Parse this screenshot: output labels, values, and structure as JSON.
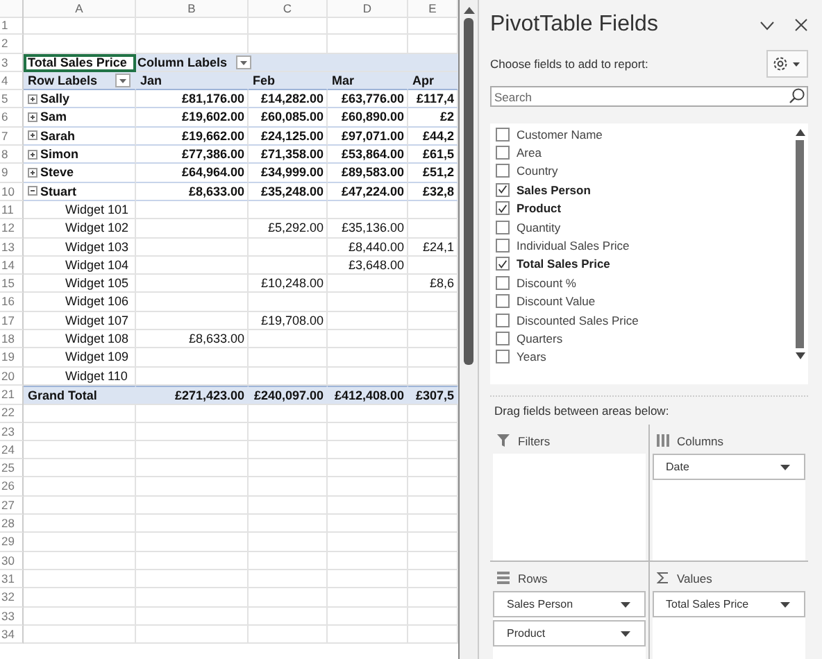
{
  "sheet": {
    "columns": [
      "A",
      "B",
      "C",
      "D",
      "E"
    ],
    "rows": [
      {
        "num": "1",
        "kind": "blank"
      },
      {
        "num": "2",
        "kind": "blank"
      },
      {
        "num": "3",
        "kind": "title",
        "cells": [
          {
            "text": "Total Sales Price",
            "selected": true
          },
          {
            "text": "Column Labels",
            "selected": false
          }
        ]
      },
      {
        "num": "4",
        "kind": "colhead",
        "label": "Row Labels",
        "values": [
          "Jan",
          "Feb",
          "Mar",
          "Apr"
        ]
      },
      {
        "num": "5",
        "kind": "group",
        "expanded": false,
        "label": "Sally",
        "values": [
          "£81,176.00",
          "£14,282.00",
          "£63,776.00",
          "£117,4"
        ]
      },
      {
        "num": "6",
        "kind": "group",
        "expanded": false,
        "label": "Sam",
        "values": [
          "£19,602.00",
          "£60,085.00",
          "£60,890.00",
          "£2"
        ]
      },
      {
        "num": "7",
        "kind": "group",
        "expanded": false,
        "label": "Sarah",
        "values": [
          "£19,662.00",
          "£24,125.00",
          "£97,071.00",
          "£44,2"
        ]
      },
      {
        "num": "8",
        "kind": "group",
        "expanded": false,
        "label": "Simon",
        "values": [
          "£77,386.00",
          "£71,358.00",
          "£53,864.00",
          "£61,5"
        ]
      },
      {
        "num": "9",
        "kind": "group",
        "expanded": false,
        "label": "Steve",
        "values": [
          "£64,964.00",
          "£34,999.00",
          "£89,583.00",
          "£51,2"
        ]
      },
      {
        "num": "10",
        "kind": "group",
        "expanded": true,
        "label": "Stuart",
        "values": [
          "£8,633.00",
          "£35,248.00",
          "£47,224.00",
          "£32,8"
        ]
      },
      {
        "num": "11",
        "kind": "item",
        "label": "Widget 101",
        "cells": [
          {
            "kind": "empty"
          },
          {
            "kind": "empty"
          },
          {
            "kind": "empty"
          },
          {
            "kind": "empty"
          }
        ]
      },
      {
        "num": "12",
        "kind": "item",
        "label": "Widget 102",
        "cells": [
          {
            "kind": "empty"
          },
          {
            "kind": "amount",
            "text": "£5,292.00"
          },
          {
            "kind": "amount",
            "text": "£35,136.00"
          },
          {
            "kind": "empty"
          }
        ]
      },
      {
        "num": "13",
        "kind": "item",
        "label": "Widget 103",
        "cells": [
          {
            "kind": "empty"
          },
          {
            "kind": "empty"
          },
          {
            "kind": "amount",
            "text": "£8,440.00"
          },
          {
            "kind": "amount",
            "text": "£24,1"
          }
        ]
      },
      {
        "num": "14",
        "kind": "item",
        "label": "Widget 104",
        "cells": [
          {
            "kind": "empty"
          },
          {
            "kind": "empty"
          },
          {
            "kind": "amount",
            "text": "£3,648.00"
          },
          {
            "kind": "empty"
          }
        ]
      },
      {
        "num": "15",
        "kind": "item",
        "label": "Widget 105",
        "cells": [
          {
            "kind": "empty"
          },
          {
            "kind": "amount",
            "text": "£10,248.00"
          },
          {
            "kind": "empty"
          },
          {
            "kind": "amount",
            "text": "£8,6"
          }
        ]
      },
      {
        "num": "16",
        "kind": "item",
        "label": "Widget 106",
        "cells": [
          {
            "kind": "empty"
          },
          {
            "kind": "empty"
          },
          {
            "kind": "empty"
          },
          {
            "kind": "empty"
          }
        ]
      },
      {
        "num": "17",
        "kind": "item",
        "label": "Widget 107",
        "cells": [
          {
            "kind": "empty"
          },
          {
            "kind": "amount",
            "text": "£19,708.00"
          },
          {
            "kind": "empty"
          },
          {
            "kind": "empty"
          }
        ]
      },
      {
        "num": "18",
        "kind": "item",
        "label": "Widget 108",
        "cells": [
          {
            "kind": "amount",
            "text": "£8,633.00"
          },
          {
            "kind": "empty"
          },
          {
            "kind": "empty"
          },
          {
            "kind": "empty"
          }
        ]
      },
      {
        "num": "19",
        "kind": "item",
        "label": "Widget 109",
        "cells": [
          {
            "kind": "empty"
          },
          {
            "kind": "empty"
          },
          {
            "kind": "empty"
          },
          {
            "kind": "empty"
          }
        ]
      },
      {
        "num": "20",
        "kind": "item",
        "label": "Widget 110",
        "cells": [
          {
            "kind": "empty"
          },
          {
            "kind": "empty"
          },
          {
            "kind": "empty"
          },
          {
            "kind": "empty"
          }
        ]
      },
      {
        "num": "21",
        "kind": "total",
        "label": "Grand Total",
        "values": [
          "£271,423.00",
          "£240,097.00",
          "£412,408.00",
          "£307,5"
        ]
      },
      {
        "num": "22",
        "kind": "blank"
      },
      {
        "num": "23",
        "kind": "blank"
      },
      {
        "num": "24",
        "kind": "blank"
      },
      {
        "num": "25",
        "kind": "blank"
      },
      {
        "num": "26",
        "kind": "blank"
      },
      {
        "num": "27",
        "kind": "blank"
      },
      {
        "num": "28",
        "kind": "blank"
      },
      {
        "num": "29",
        "kind": "blank"
      },
      {
        "num": "30",
        "kind": "blank"
      },
      {
        "num": "31",
        "kind": "blank"
      },
      {
        "num": "32",
        "kind": "blank"
      },
      {
        "num": "33",
        "kind": "blank"
      },
      {
        "num": "34",
        "kind": "blank"
      }
    ]
  },
  "pane": {
    "title": "PivotTable Fields",
    "subtitle": "Choose fields to add to report:",
    "search": {
      "placeholder": "Search"
    },
    "fields": [
      {
        "label": "Customer Name",
        "checked": false
      },
      {
        "label": "Area",
        "checked": false
      },
      {
        "label": "Country",
        "checked": false
      },
      {
        "label": "Sales Person",
        "checked": true
      },
      {
        "label": "Product",
        "checked": true
      },
      {
        "label": "Quantity",
        "checked": false
      },
      {
        "label": "Individual Sales Price",
        "checked": false
      },
      {
        "label": "Total Sales Price",
        "checked": true
      },
      {
        "label": "Discount %",
        "checked": false
      },
      {
        "label": "Discount Value",
        "checked": false
      },
      {
        "label": "Discounted Sales Price",
        "checked": false
      },
      {
        "label": "Quarters",
        "checked": false
      },
      {
        "label": "Years",
        "checked": false
      }
    ],
    "areas_hint": "Drag fields between areas below:",
    "areas": [
      {
        "kind": "filters",
        "label": "Filters"
      },
      {
        "kind": "columns",
        "label": "Columns",
        "items": [
          "Date"
        ]
      },
      {
        "kind": "rows",
        "label": "Rows",
        "items": [
          "Sales Person",
          "Product"
        ]
      },
      {
        "kind": "values",
        "label": "Values",
        "items": [
          "Total Sales Price"
        ]
      }
    ]
  }
}
